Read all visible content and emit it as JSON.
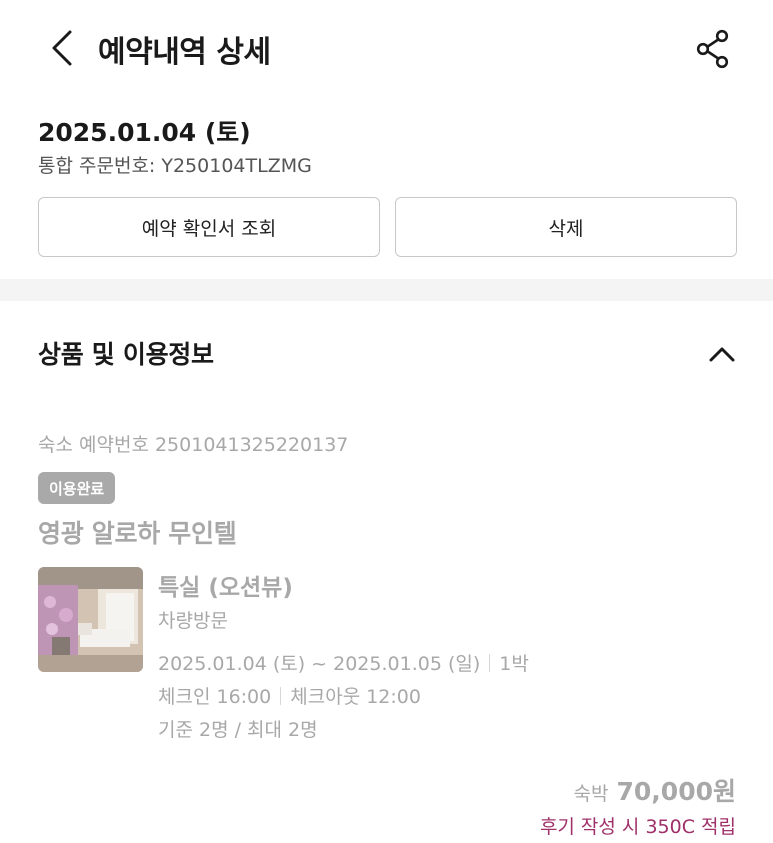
{
  "header": {
    "title": "예약내역 상세",
    "back_icon": "chevron-left-icon",
    "share_icon": "share-icon"
  },
  "order": {
    "date": "2025.01.04 (토)",
    "order_number": "통합 주문번호: Y250104TLZMG"
  },
  "actions": {
    "confirm_label": "예약 확인서 조회",
    "delete_label": "삭제"
  },
  "section": {
    "title": "상품 및 이용정보",
    "toggle_icon": "chevron-up-icon"
  },
  "reservation": {
    "stay_number": "숙소 예약번호 2501041325220137",
    "status": "이용완료",
    "hotel_name": "영광 알로하 무인텔",
    "room_name": "특실 (오션뷰)",
    "visit_type": "차량방문",
    "dates": "2025.01.04 (토) ~ 2025.01.05 (일)",
    "nights": "1박",
    "checkin": "체크인 16:00",
    "checkout": "체크아웃 12:00",
    "guests": "기준 2명 / 최대 2명",
    "price_label": "숙박",
    "price_value": "70,000원",
    "review_point": "후기 작성 시 350C 적립"
  },
  "colors": {
    "text_primary": "#1a1a1a",
    "text_muted": "#a8a8a8",
    "badge_bg": "#a9a9a9",
    "accent_point": "#a0306a",
    "divider_band": "#f4f4f4"
  }
}
